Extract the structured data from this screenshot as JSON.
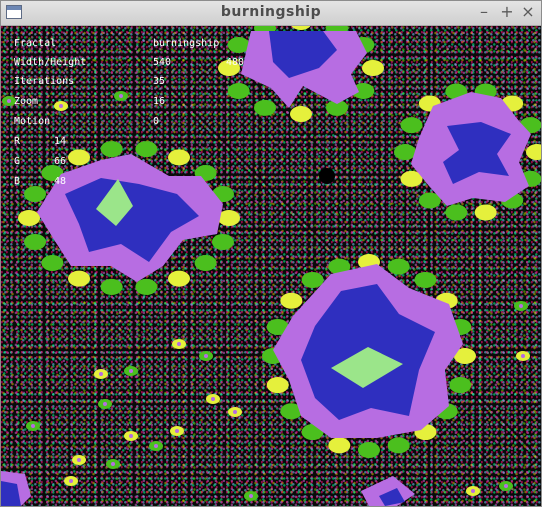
{
  "window": {
    "title": "burningship",
    "minimize_glyph": "–",
    "maximize_glyph": "+",
    "close_glyph": "×"
  },
  "info": [
    {
      "label": "Fractal",
      "value": "burningship"
    },
    {
      "label": "Width/Height",
      "value": "540",
      "value2": "480"
    },
    {
      "label": "Iterations",
      "value": "35"
    },
    {
      "label": "Zoom",
      "value": "16"
    },
    {
      "label": "Motion",
      "value": "0"
    },
    {
      "label": "R",
      "value": "14"
    },
    {
      "label": "G",
      "value": "66"
    },
    {
      "label": "B",
      "value": "48"
    }
  ],
  "colors": {
    "outer": "#b76de2",
    "inner": "#2f2fbf",
    "core": "#9be58a",
    "fringe_green": "#4bbf1e",
    "fringe_yellow": "#e5f03c",
    "background": "#0b0b0b"
  }
}
